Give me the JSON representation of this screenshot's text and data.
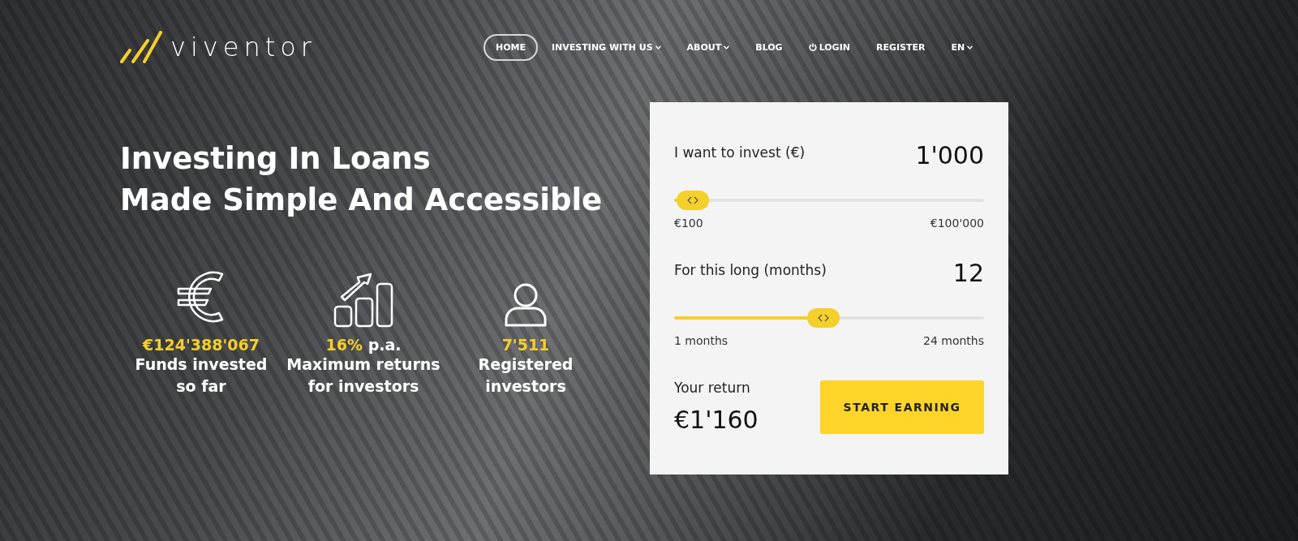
{
  "header": {
    "logo": "viventor",
    "nav": [
      {
        "label": "HOME",
        "selected": true,
        "dropdown": false
      },
      {
        "label": "INVESTING WITH US",
        "selected": false,
        "dropdown": true
      },
      {
        "label": "ABOUT",
        "selected": false,
        "dropdown": true
      },
      {
        "label": "BLOG",
        "selected": false,
        "dropdown": false
      },
      {
        "label": "LOGIN",
        "selected": false,
        "dropdown": false
      },
      {
        "label": "REGISTER",
        "selected": false,
        "dropdown": false
      },
      {
        "label": "EN",
        "selected": false,
        "dropdown": true
      }
    ]
  },
  "hero": {
    "headline": [
      "Investing In Loans",
      "Made Simple And Accessible"
    ],
    "stats": [
      {
        "value": "€124'388'067",
        "label": "Funds invested so far"
      },
      {
        "value": "16%",
        "suffix": "p.a.",
        "label": "Maximum returns for investors"
      },
      {
        "value": "7'511",
        "label": "Registered investors"
      }
    ]
  },
  "calculator": {
    "sliders": [
      {
        "label": "I want to invest (€)",
        "value": "1'000",
        "level": 0.01,
        "min": "€100",
        "max": "€100'000"
      },
      {
        "label": "For this long (months)",
        "value": "12",
        "level": 0.48,
        "min": "1 months",
        "max": "24 months"
      }
    ],
    "return_label": "Your return",
    "return_value": "€1'160",
    "button": "START EARNING"
  }
}
